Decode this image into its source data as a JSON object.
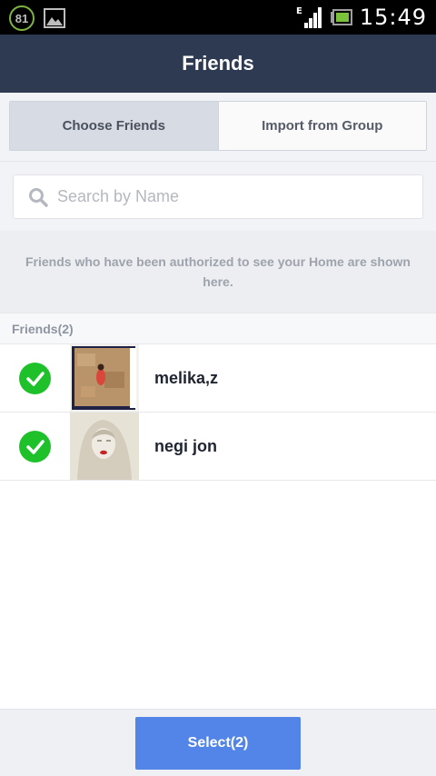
{
  "status_bar": {
    "battery_badge": "81",
    "clock": "15:49",
    "network": "E",
    "icons": [
      "battery-saver-icon",
      "gallery-icon",
      "signal-icon",
      "battery-icon"
    ]
  },
  "header": {
    "title": "Friends"
  },
  "tabs": [
    {
      "label": "Choose Friends",
      "selected": true
    },
    {
      "label": "Import from Group",
      "selected": false
    }
  ],
  "search": {
    "placeholder": "Search by Name",
    "value": ""
  },
  "notice": "Friends who have been authorized to see your Home are shown here.",
  "section": {
    "label": "Friends(2)"
  },
  "friends": [
    {
      "name": "melika,z",
      "checked": true
    },
    {
      "name": "negi jon",
      "checked": true
    }
  ],
  "footer": {
    "select_label": "Select(2)"
  },
  "colors": {
    "header_bg": "#2e3a52",
    "check_green": "#1fc12a",
    "button_blue": "#5384e8"
  }
}
